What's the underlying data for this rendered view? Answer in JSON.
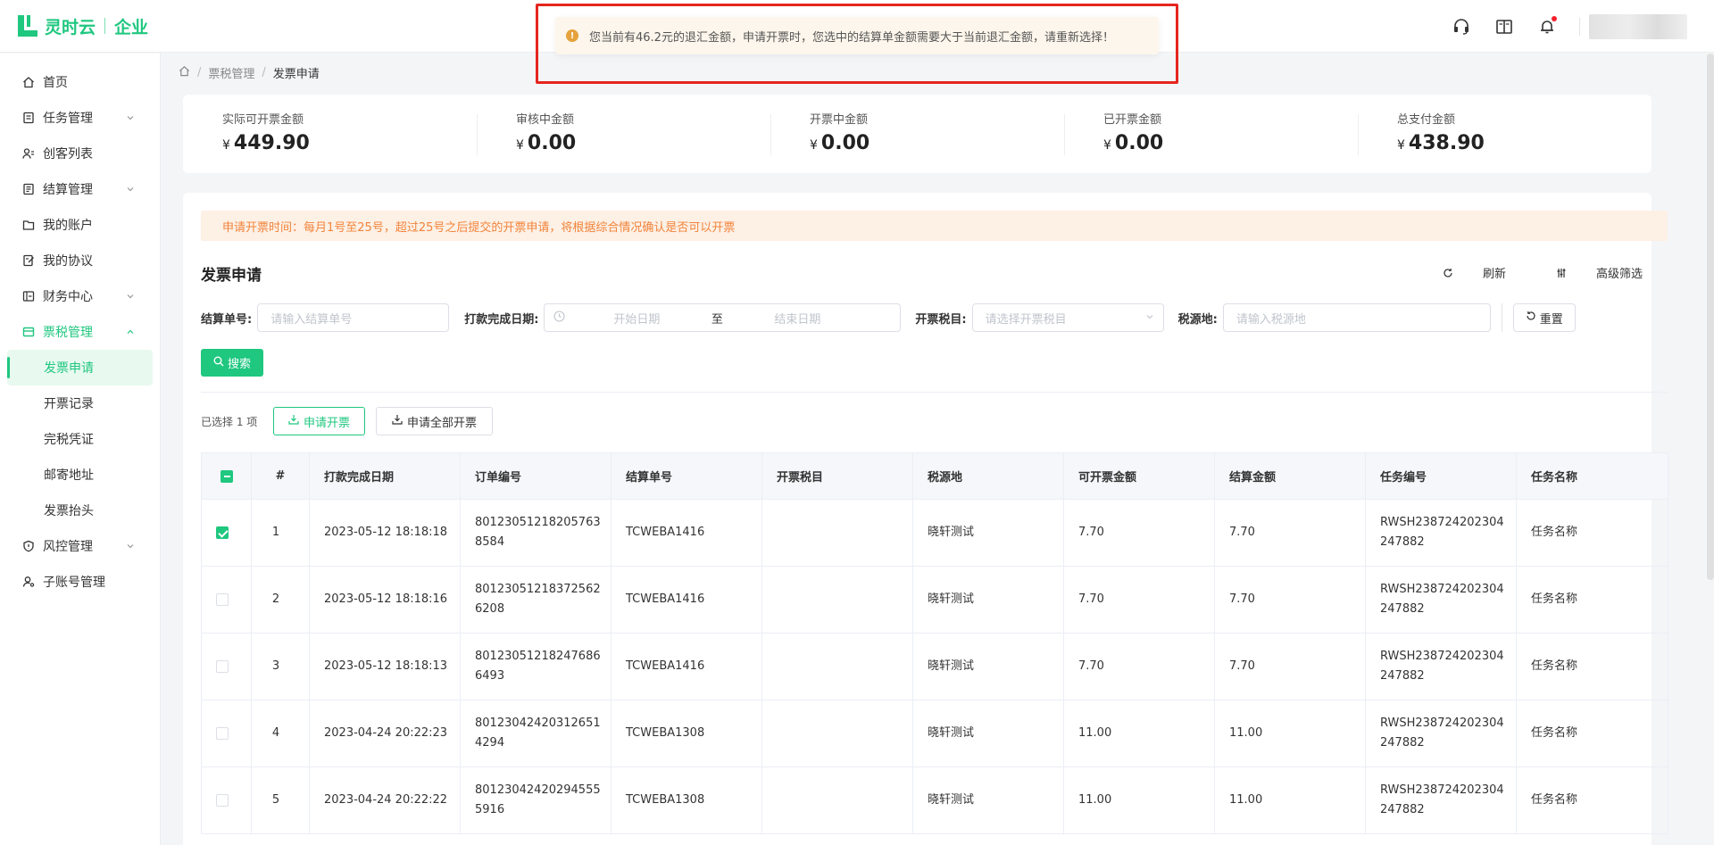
{
  "brand": {
    "name": "灵时云",
    "sub": "企业"
  },
  "alert": {
    "message": "您当前有46.2元的退汇金额，申请开票时，您选中的结算单金额需要大于当前退汇金额，请重新选择！"
  },
  "sidebar": {
    "items": [
      {
        "label": "首页",
        "icon": "home-icon"
      },
      {
        "label": "任务管理",
        "icon": "task-icon",
        "expandable": true
      },
      {
        "label": "创客列表",
        "icon": "users-icon"
      },
      {
        "label": "结算管理",
        "icon": "settlement-icon",
        "expandable": true
      },
      {
        "label": "我的账户",
        "icon": "wallet-icon"
      },
      {
        "label": "我的协议",
        "icon": "agreement-icon"
      },
      {
        "label": "财务中心",
        "icon": "finance-icon",
        "expandable": true
      },
      {
        "label": "票税管理",
        "icon": "invoice-icon",
        "expandable": true,
        "expanded": true
      }
    ],
    "subitems": [
      "发票申请",
      "开票记录",
      "完税凭证",
      "邮寄地址",
      "发票抬头"
    ],
    "items_after": [
      {
        "label": "风控管理",
        "icon": "shield-icon",
        "expandable": true
      },
      {
        "label": "子账号管理",
        "icon": "sub-account-icon"
      }
    ]
  },
  "breadcrumb": {
    "parent": "票税管理",
    "current": "发票申请"
  },
  "stats": [
    {
      "label": "实际可开票金额",
      "currency": "¥",
      "value": "449.90"
    },
    {
      "label": "审核中金额",
      "currency": "¥",
      "value": "0.00"
    },
    {
      "label": "开票中金额",
      "currency": "¥",
      "value": "0.00"
    },
    {
      "label": "已开票金额",
      "currency": "¥",
      "value": "0.00"
    },
    {
      "label": "总支付金额",
      "currency": "¥",
      "value": "438.90"
    }
  ],
  "notice": "申请开票时间：每月1号至25号，超过25号之后提交的开票申请，将根据综合情况确认是否可以开票",
  "section_title": "发票申请",
  "tools": {
    "refresh": "刷新",
    "advanced": "高级筛选"
  },
  "filters": {
    "settle_no_label": "结算单号:",
    "settle_no_placeholder": "请输入结算单号",
    "date_label": "打款完成日期:",
    "date_start": "开始日期",
    "date_to": "至",
    "date_end": "结束日期",
    "tax_item_label": "开票税目:",
    "tax_item_placeholder": "请选择开票税目",
    "tax_place_label": "税源地:",
    "tax_place_placeholder": "请输入税源地",
    "reset": "重置",
    "search": "搜索"
  },
  "actions": {
    "selected": "已选择 1 项",
    "apply": "申请开票",
    "apply_all": "申请全部开票"
  },
  "table": {
    "headers": [
      "#",
      "打款完成日期",
      "订单编号",
      "结算单号",
      "开票税目",
      "税源地",
      "可开票金额",
      "结算金额",
      "任务编号",
      "任务名称"
    ],
    "rows": [
      {
        "checked": true,
        "idx": "1",
        "date": "2023-05-12 18:18:18",
        "order": "801230512182057638584",
        "settle": "TCWEBA1416",
        "tax_item": "",
        "place": "晓轩测试",
        "avail": "7.70",
        "amount": "7.70",
        "task_no": "RWSH238724202304247882",
        "task_name": "任务名称"
      },
      {
        "checked": false,
        "idx": "2",
        "date": "2023-05-12 18:18:16",
        "order": "801230512183725626208",
        "settle": "TCWEBA1416",
        "tax_item": "",
        "place": "晓轩测试",
        "avail": "7.70",
        "amount": "7.70",
        "task_no": "RWSH238724202304247882",
        "task_name": "任务名称"
      },
      {
        "checked": false,
        "idx": "3",
        "date": "2023-05-12 18:18:13",
        "order": "801230512182476866493",
        "settle": "TCWEBA1416",
        "tax_item": "",
        "place": "晓轩测试",
        "avail": "7.70",
        "amount": "7.70",
        "task_no": "RWSH238724202304247882",
        "task_name": "任务名称"
      },
      {
        "checked": false,
        "idx": "4",
        "date": "2023-04-24 20:22:23",
        "order": "801230424203126514294",
        "settle": "TCWEBA1308",
        "tax_item": "",
        "place": "晓轩测试",
        "avail": "11.00",
        "amount": "11.00",
        "task_no": "RWSH238724202304247882",
        "task_name": "任务名称"
      },
      {
        "checked": false,
        "idx": "5",
        "date": "2023-04-24 20:22:22",
        "order": "801230424202945555916",
        "settle": "TCWEBA1308",
        "tax_item": "",
        "place": "晓轩测试",
        "avail": "11.00",
        "amount": "11.00",
        "task_no": "RWSH238724202304247882",
        "task_name": "任务名称"
      }
    ]
  },
  "colors": {
    "brand": "#1fc77f",
    "alert_border": "#e5261f",
    "notice_text": "#f2843b"
  }
}
